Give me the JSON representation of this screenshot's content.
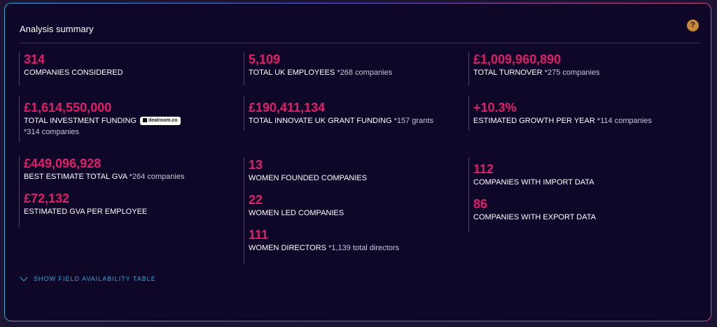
{
  "header": {
    "title": "Analysis summary",
    "help": "?"
  },
  "stats": {
    "companies": {
      "value": "314",
      "label": "COMPANIES CONSIDERED"
    },
    "employees": {
      "value": "5,109",
      "label": "TOTAL UK EMPLOYEES",
      "note": "*268 companies"
    },
    "turnover": {
      "value": "£1,009,960,890",
      "label": "TOTAL TURNOVER",
      "note": "*275 companies"
    },
    "investment": {
      "value": "£1,614,550,000",
      "label": "TOTAL INVESTMENT FUNDING",
      "badge": "dealroom.co",
      "note": "*314 companies"
    },
    "innovate": {
      "value": "£190,411,134",
      "label": "TOTAL INNOVATE UK GRANT FUNDING",
      "note": "*157 grants"
    },
    "growth": {
      "value": "+10.3%",
      "label": "ESTIMATED GROWTH PER YEAR",
      "note": "*114 companies"
    },
    "gva_total": {
      "value": "£449,096,928",
      "label": "BEST ESTIMATE TOTAL GVA",
      "note": "*264 companies"
    },
    "gva_employee": {
      "value": "£72,132",
      "label": "ESTIMATED GVA PER EMPLOYEE"
    },
    "women_founded": {
      "value": "13",
      "label": "WOMEN FOUNDED COMPANIES"
    },
    "women_led": {
      "value": "22",
      "label": "WOMEN LED COMPANIES"
    },
    "women_directors": {
      "value": "111",
      "label": "WOMEN DIRECTORS",
      "note": "*1,139 total directors"
    },
    "import": {
      "value": "112",
      "label": "COMPANIES WITH IMPORT DATA"
    },
    "export": {
      "value": "86",
      "label": "COMPANIES WITH EXPORT DATA"
    }
  },
  "footer": {
    "toggle_label": "SHOW FIELD AVAILABILITY TABLE"
  },
  "colors": {
    "accent": "#e01e6a",
    "link": "#34a7d6",
    "background": "#0e0727"
  }
}
